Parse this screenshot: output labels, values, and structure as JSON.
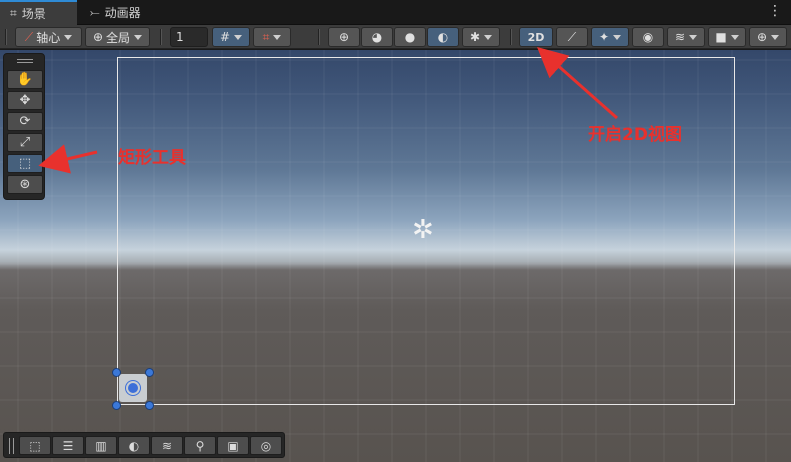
{
  "tabs": [
    {
      "label": "场景",
      "icon": "grid-icon",
      "active": true
    },
    {
      "label": "动画器",
      "icon": "animator-icon",
      "active": false
    }
  ],
  "toolbar": {
    "pivot_label": "轴心",
    "global_label": "全局",
    "grid_size_value": "1",
    "mode_2d_label": "2D"
  },
  "annotations": {
    "rect_tool_label": "矩形工具",
    "open_2d_label": "开启2D视图",
    "color": "#e8312d"
  },
  "colors": {
    "accent": "#2f8bd6",
    "selected_tool": "#46607c",
    "handle": "#3b78d8"
  }
}
